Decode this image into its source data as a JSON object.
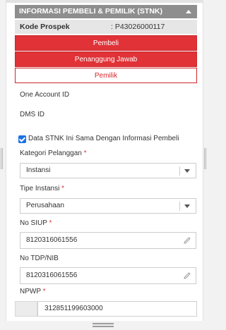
{
  "section": {
    "title": "INFORMASI PEMBELI & PEMILIK (STNK)",
    "collapse_icon": "caret-up-icon"
  },
  "prospect": {
    "label": "Kode Prospek",
    "value": ": P43026000117"
  },
  "tabs": [
    {
      "label": "Pembeli",
      "active": true
    },
    {
      "label": "Penanggung Jawab",
      "active": true
    },
    {
      "label": "Pemilik",
      "active": false
    }
  ],
  "fields": {
    "one_account_label": "One Account ID",
    "dms_label": "DMS ID",
    "same_info_label": "Data STNK Ini Sama Dengan Informasi Pembeli",
    "same_info_checked": true,
    "kategori_label": "Kategori Pelanggan",
    "kategori_value": "Instansi",
    "tipe_label": "Tipe Instansi",
    "tipe_value": "Perusahaan",
    "siup_label": "No SIUP",
    "siup_value": "8120316061556",
    "tdp_label": "No TDP/NIB",
    "tdp_value": "8120316061556",
    "npwp_label": "NPWP",
    "npwp_value": "312851199603000",
    "required_mark": "*"
  },
  "colors": {
    "accent": "#e03237",
    "header": "#8e8e8e",
    "checkbox": "#1a73e8"
  },
  "icons": {
    "edit": "pencil-icon",
    "dropdown": "chevron-down-icon",
    "resize": "drag-handle-icon"
  }
}
